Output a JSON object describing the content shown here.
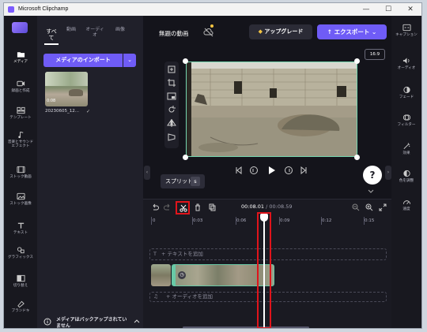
{
  "window": {
    "title": "Microsoft Clipchamp",
    "minimize": "—",
    "maximize": "☐",
    "close": "✕"
  },
  "rail": [
    {
      "label": "メディア",
      "icon": "folder-icon"
    },
    {
      "label": "録画と作成",
      "icon": "camera-icon"
    },
    {
      "label": "テンプレート",
      "icon": "template-icon"
    },
    {
      "label": "音楽とサウンドエフェクト",
      "icon": "music-icon"
    },
    {
      "label": "ストック動画",
      "icon": "film-icon"
    },
    {
      "label": "ストック画像",
      "icon": "image-icon"
    },
    {
      "label": "テキスト",
      "icon": "text-icon"
    },
    {
      "label": "グラフィックス",
      "icon": "shapes-icon"
    },
    {
      "label": "切り替え",
      "icon": "transition-icon"
    },
    {
      "label": "ブランドキ",
      "icon": "brand-icon"
    }
  ],
  "media_panel": {
    "tabs": [
      "すべて",
      "動画",
      "オーディオ",
      "画像"
    ],
    "import_label": "メディアのインポート",
    "import_dropdown": "⌄",
    "thumb_duration": "0:08",
    "thumb_name": "20230605_12...",
    "backup_notice": "メディアはバックアップされていません"
  },
  "header": {
    "project_title": "無題の動画",
    "upgrade_label": "アップグレード",
    "export_label": "エクスポート",
    "aspect_ratio": "16:9"
  },
  "preview": {
    "split_tooltip": "スプリット",
    "split_key": "s",
    "help": "?"
  },
  "timeline": {
    "current_time": "00:08.01",
    "separator": " / ",
    "total_time": "00:08.59",
    "ruler": [
      "0",
      "0:03",
      "0:06",
      "0:09",
      "0:12",
      "0:15"
    ],
    "text_track": "テキストを追加",
    "audio_track": "オーディオを追加"
  },
  "right_rail": [
    {
      "label": "キャプション",
      "icon": "captions-icon"
    },
    {
      "label": "オーディオ",
      "icon": "speaker-icon"
    },
    {
      "label": "フェード",
      "icon": "fade-icon"
    },
    {
      "label": "フィルター",
      "icon": "filter-icon"
    },
    {
      "label": "効果",
      "icon": "effects-icon"
    },
    {
      "label": "色を調整",
      "icon": "color-adjust-icon"
    },
    {
      "label": "速度",
      "icon": "speed-icon"
    }
  ],
  "colors": {
    "accent": "#6f5cf6",
    "highlight": "#e0141b",
    "selection": "#68c9a6"
  }
}
